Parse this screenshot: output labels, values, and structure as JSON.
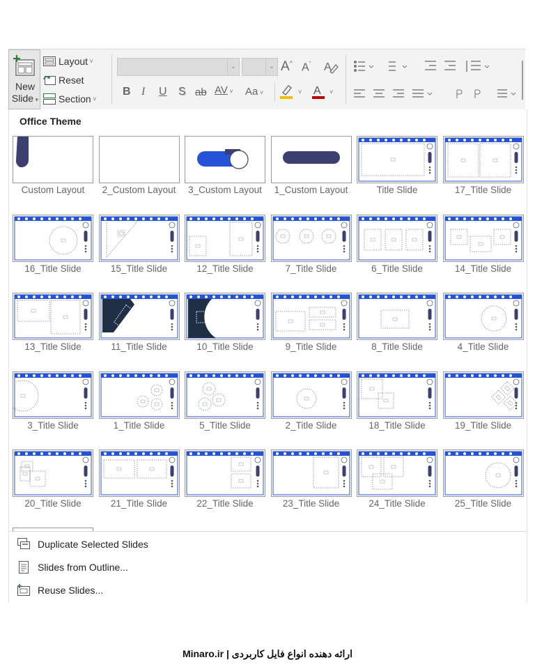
{
  "ribbon": {
    "new_slide_line1": "New",
    "new_slide_line2": "Slide",
    "layout_label": "Layout",
    "reset_label": "Reset",
    "section_label": "Section",
    "font_name_value": "",
    "font_size_value": "",
    "bold_glyph": "B",
    "italic_glyph": "I",
    "underline_glyph": "U",
    "shadow_glyph": "S",
    "strike_glyph": "ab",
    "spacing_glyph": "AV",
    "case_glyph": "Aa",
    "font_color_glyph": "A",
    "grow_glyph": "A",
    "shrink_glyph": "A",
    "accent_color": "#2e7d32",
    "highlight_color": "#f0c000",
    "font_color": "#c00000"
  },
  "gallery": {
    "title": "Office Theme",
    "layouts": [
      "Custom Layout",
      "2_Custom Layout",
      "3_Custom Layout",
      "1_Custom Layout",
      "Title Slide",
      "17_Title Slide",
      "16_Title Slide",
      "15_Title Slide",
      "12_Title Slide",
      "7_Title Slide",
      "6_Title Slide",
      "14_Title Slide",
      "13_Title Slide",
      "11_Title Slide",
      "10_Title Slide",
      "9_Title Slide",
      "8_Title Slide",
      "4_Title Slide",
      "3_Title Slide",
      "1_Title Slide",
      "5_Title Slide",
      "2_Title Slide",
      "18_Title Slide",
      "19_Title Slide",
      "20_Title Slide",
      "21_Title Slide",
      "22_Title Slide",
      "23_Title Slide",
      "24_Title Slide",
      "25_Title Slide"
    ],
    "colors": {
      "navy": "#3b4070",
      "blue": "#2453d6",
      "dark": "#1f2f45"
    }
  },
  "menu": {
    "duplicate": "Duplicate Selected Slides",
    "outline": "Slides from Outline...",
    "reuse": "Reuse Slides..."
  },
  "footer": "Minaro.ir | ارائه دهنده انواع فایل کاربردی"
}
